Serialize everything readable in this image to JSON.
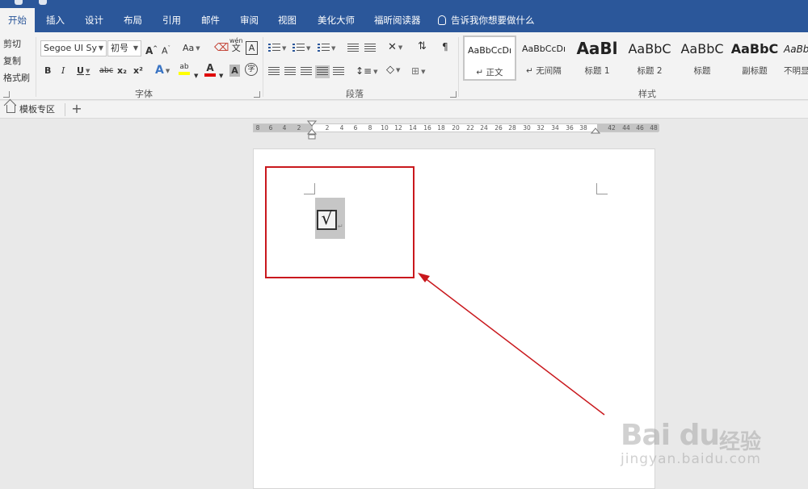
{
  "ribbon_tabs": [
    "开始",
    "插入",
    "设计",
    "布局",
    "引用",
    "邮件",
    "审阅",
    "视图",
    "美化大师",
    "福昕阅读器"
  ],
  "active_tab": "开始",
  "tell_me": "告诉我你想要做什么",
  "clipboard": {
    "cut": "剪切",
    "copy": "复制",
    "format_painter": "格式刷"
  },
  "font": {
    "name": "Segoe UI Sy",
    "size": "初号",
    "group_label": "字体",
    "grow": "A",
    "shrink": "A",
    "change_case": "Aa",
    "phonetic": "wén",
    "border_char": "A",
    "bold": "B",
    "italic": "I",
    "underline": "U",
    "strike": "abc",
    "subscript": "x₂",
    "superscript": "x²",
    "text_effects": "A",
    "highlight": "ab",
    "font_color": "A",
    "shading": "A",
    "enclose": "字"
  },
  "paragraph": {
    "group_label": "段落"
  },
  "styles": {
    "group_label": "样式",
    "items": [
      {
        "preview": "AaBbCcDı",
        "name": "↵ 正文"
      },
      {
        "preview": "AaBbCcDı",
        "name": "↵ 无间隔"
      },
      {
        "preview": "AaBl",
        "name": "标题 1"
      },
      {
        "preview": "AaBbC",
        "name": "标题 2"
      },
      {
        "preview": "AaBbC",
        "name": "标题"
      },
      {
        "preview": "AaBbC",
        "name": "副标题"
      },
      {
        "preview": "AaBb",
        "name": "不明显"
      }
    ]
  },
  "template_tab": "模板专区",
  "add_tab": "+",
  "ruler": {
    "left_labels": [
      "8",
      "6",
      "4",
      "2"
    ],
    "right_labels": [
      "2",
      "4",
      "6",
      "8",
      "10",
      "12",
      "14",
      "16",
      "18",
      "20",
      "22",
      "24",
      "26",
      "28",
      "30",
      "32",
      "34",
      "36",
      "38",
      "42",
      "44",
      "46",
      "48"
    ]
  },
  "document": {
    "checkbox_symbol": "√",
    "paragraph_mark": "↵"
  },
  "colors": {
    "ribbon_blue": "#2b579a",
    "annotation_red": "#c9181d",
    "highlight_yellow": "#ffff00",
    "font_color_red": "#e00000"
  },
  "watermark": {
    "logo": "Bai du",
    "cn": "经验",
    "url": "jingyan.baidu.com"
  }
}
